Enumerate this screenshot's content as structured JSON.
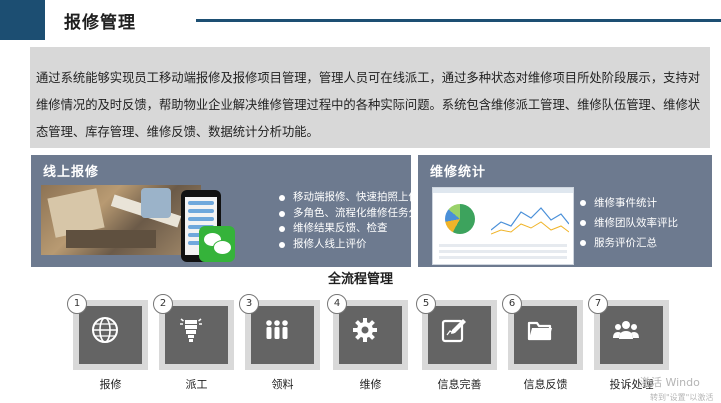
{
  "header": {
    "title": "报修管理"
  },
  "intro": "通过系统能够实现员工移动端报修及报修项目管理，管理人员可在线派工，通过多种状态对维修项目所处阶段展示，支持对维修情况的及时反馈，帮助物业企业解决维修管理过程中的各种实际问题。系统包含维修派工管理、维修队伍管理、维修状态管理、库存管理、维修反馈、数据统计分析功能。",
  "online_repair": {
    "title": "线上报修",
    "items": [
      "移动端报修、快速拍照上传",
      "多角色、流程化维修任务分配",
      "维修结果反馈、检查",
      "报修人线上评价"
    ]
  },
  "repair_stats": {
    "title": "维修统计",
    "items": [
      "维修事件统计",
      "维修团队效率评比",
      "服务评价汇总"
    ]
  },
  "process": {
    "title": "全流程管理",
    "steps": [
      {
        "num": "1",
        "label": "报修",
        "icon": "globe-icon"
      },
      {
        "num": "2",
        "label": "派工",
        "icon": "lightbulb-icon"
      },
      {
        "num": "3",
        "label": "领料",
        "icon": "people-icon"
      },
      {
        "num": "4",
        "label": "维修",
        "icon": "gear-icon"
      },
      {
        "num": "5",
        "label": "信息完善",
        "icon": "edit-icon"
      },
      {
        "num": "6",
        "label": "信息反馈",
        "icon": "folder-icon"
      },
      {
        "num": "7",
        "label": "投诉处理",
        "icon": "group-icon"
      }
    ]
  },
  "watermark": {
    "line1": "激活 Windo",
    "line2": "转到\"设置\"以激活"
  },
  "colors": {
    "header_bar": "#1c4e72",
    "panel": "#6d7a8f",
    "intro_bg": "#d8d8d8",
    "step_dark": "#646464"
  }
}
